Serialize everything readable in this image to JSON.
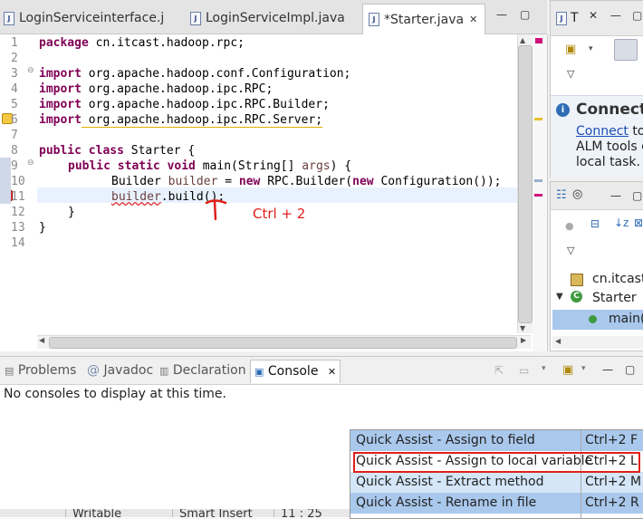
{
  "editor_tabs": [
    {
      "label": "LoginServiceinterface.j"
    },
    {
      "label": "LoginServiceImpl.java"
    },
    {
      "label": "*Starter.java",
      "active": true
    }
  ],
  "editor": {
    "lines": [
      {
        "num": "1"
      },
      {
        "num": "2"
      },
      {
        "num": "3"
      },
      {
        "num": "4"
      },
      {
        "num": "5"
      },
      {
        "num": "6"
      },
      {
        "num": "7"
      },
      {
        "num": "8"
      },
      {
        "num": "9"
      },
      {
        "num": "10"
      },
      {
        "num": "11"
      },
      {
        "num": "12"
      },
      {
        "num": "13"
      },
      {
        "num": "14"
      }
    ],
    "code": {
      "l1_kw": "package",
      "l1_rest": " cn.itcast.hadoop.rpc;",
      "l3_kw": "import",
      "l3_rest": " org.apache.hadoop.conf.Configuration;",
      "l4_kw": "import",
      "l4_rest": " org.apache.hadoop.ipc.RPC;",
      "l5_kw": "import",
      "l5_rest": " org.apache.hadoop.ipc.RPC.Builder;",
      "l6_kw": "import",
      "l6_rest": " org.apache.hadoop.ipc.RPC.Server;",
      "l8_kw": "public class",
      "l8_rest": " Starter {",
      "l9_kw": "public static void",
      "l9_rest": " main(String[] ",
      "l9_var": "args",
      "l9_end": ") {",
      "l10_type": "Builder ",
      "l10_var": "builder",
      "l10_mid": " = ",
      "l10_kw": "new",
      "l10_mid2": " RPC.Builder(",
      "l10_kw2": "new",
      "l10_end": " Configuration());",
      "l11_var": "builder",
      "l11_rest": ".build();",
      "l12": "}",
      "l13": "}"
    },
    "annotation": "Ctrl + 2"
  },
  "right_panel_top": {
    "tab_label": "T",
    "connect_title": "Connect",
    "link_text": "Connect",
    "text_after_link": " to",
    "line2": "ALM tools c",
    "line3": "local task."
  },
  "right_panel_bottom": {
    "package_label": "cn.itcast",
    "class_label": "Starter",
    "method_label": "main("
  },
  "bottom_tabs": [
    {
      "label": "Problems"
    },
    {
      "label": "Javadoc"
    },
    {
      "label": "Declaration"
    },
    {
      "label": "Console",
      "active": true
    }
  ],
  "console_message": "No consoles to display at this time.",
  "status_bar": {
    "writable": "Writable",
    "insert": "Smart Insert",
    "position": "11 : 25"
  },
  "quick_assist": [
    {
      "label": "Quick Assist - Assign to field",
      "shortcut": "Ctrl+2 F"
    },
    {
      "label": "Quick Assist - Assign to local variable",
      "shortcut": "Ctrl+2 L"
    },
    {
      "label": "Quick Assist - Extract method",
      "shortcut": "Ctrl+2 M"
    },
    {
      "label": "Quick Assist - Rename in file",
      "shortcut": "Ctrl+2 R"
    }
  ],
  "colors": {
    "keyword": "#7f0055",
    "annotation_red": "#e0201a",
    "selection": "#a9c8ec",
    "popup_row": "#d4e6f8"
  }
}
